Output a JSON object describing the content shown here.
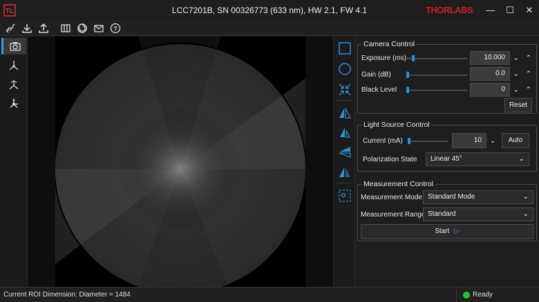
{
  "window": {
    "title": "LCC7201B, SN 00326773 (633 nm), HW 2.1, FW 4.1",
    "brand": "THORLABS",
    "minimize": "—",
    "maximize": "☐",
    "close": "✕"
  },
  "toolbar": {
    "icons": [
      "connect-icon",
      "download-icon",
      "upload-icon",
      "grid-icon",
      "refresh-icon",
      "email-icon",
      "help-icon"
    ]
  },
  "sidebar": {
    "items": [
      "camera-icon",
      "axes-icon",
      "axes-rotate-icon",
      "network-icon"
    ]
  },
  "camera_control": {
    "title": "Camera Control",
    "exposure_label": "Exposure (ms)",
    "exposure_value": "10.000",
    "gain_label": "Gain (dB)",
    "gain_value": "0.0",
    "black_level_label": "Black Level",
    "black_level_value": "0",
    "reset_label": "Reset"
  },
  "light_source_control": {
    "title": "Light Source Control",
    "current_label": "Current (mA)",
    "current_value": "10",
    "auto_label": "Auto",
    "polarization_label": "Polarization State",
    "polarization_value": "Linear 45°"
  },
  "measurement_control": {
    "title": "Measurement Control",
    "mode_label": "Measurement Mode",
    "mode_value": "Standard Mode",
    "range_label": "Measurement Range",
    "range_value": "Standard",
    "start_label": "Start"
  },
  "status": {
    "roi_text": "Current ROI Dimension: Diameter = 1484",
    "state_text": "Ready",
    "state_color": "#22c42e"
  },
  "colors": {
    "accent": "#2e8fd0",
    "brand": "#c8202f"
  }
}
